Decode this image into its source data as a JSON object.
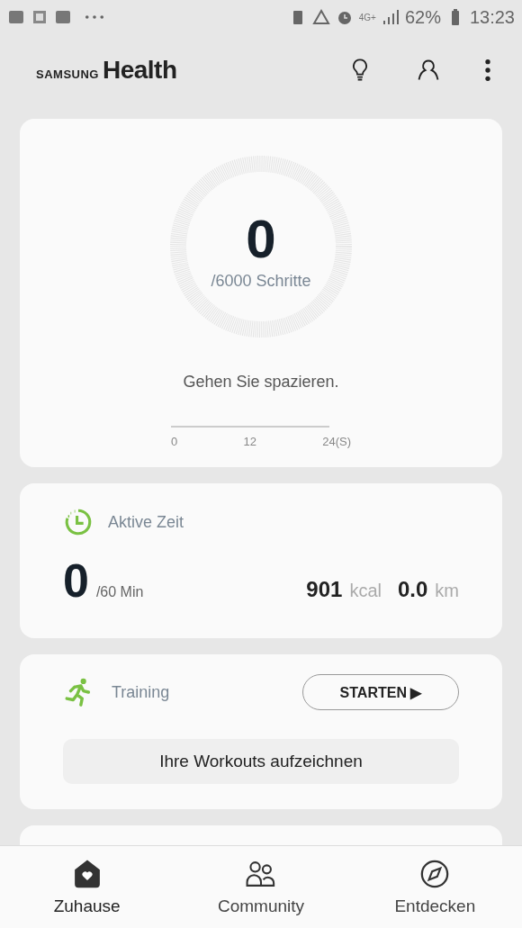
{
  "status_bar": {
    "network": "4G+",
    "battery": "62%",
    "time": "13:23"
  },
  "header": {
    "brand": "SAMSUNG",
    "product": "Health"
  },
  "steps": {
    "count": "0",
    "goal": "/6000 Schritte",
    "level": 0,
    "message": "Gehen Sie spazieren.",
    "axis": [
      "0",
      "12",
      "24(S)"
    ]
  },
  "active_time": {
    "title": "Aktive Zeit",
    "value": "0",
    "goal": "/60 Min",
    "calories": "901",
    "calories_unit": "kcal",
    "distance": "0.0",
    "distance_unit": "km"
  },
  "training": {
    "title": "Training",
    "button": "STARTEN ▶",
    "action": "Ihre Workouts aufzeichnen"
  },
  "nav": [
    {
      "label": "Zuhause",
      "selected": true
    },
    {
      "label": "Community",
      "selected": false
    },
    {
      "label": "Entdecken",
      "selected": false
    }
  ]
}
